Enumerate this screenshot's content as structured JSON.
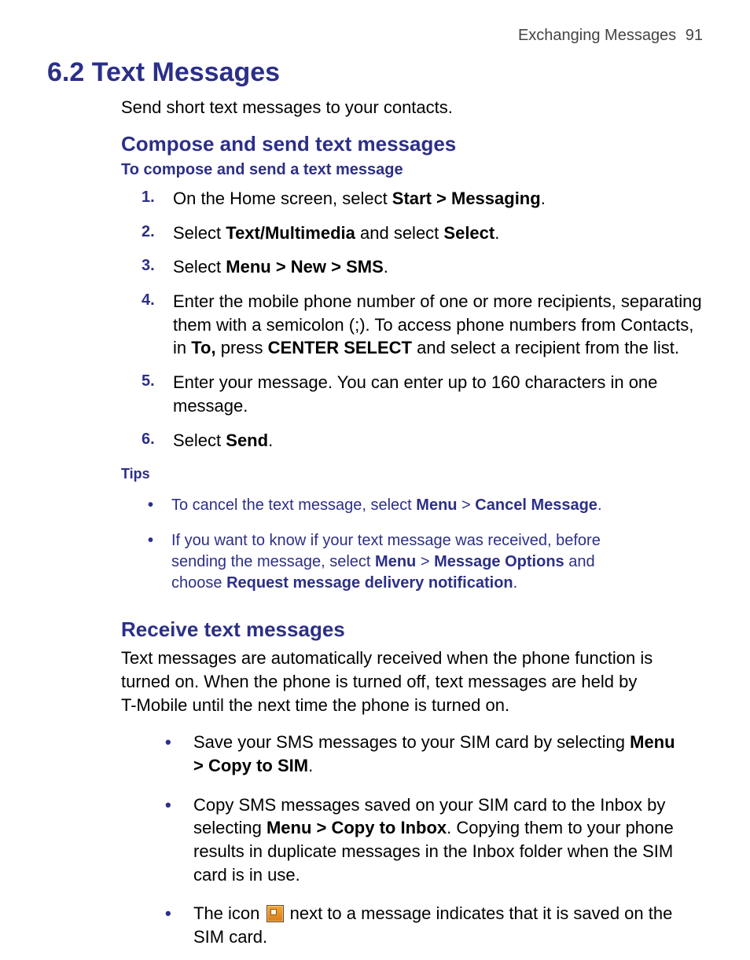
{
  "runningHead": {
    "title": "Exchanging Messages",
    "pageNumber": "91"
  },
  "sectionTitle": "6.2 Text Messages",
  "intro": "Send short text messages to your contacts.",
  "compose": {
    "heading": "Compose and send text messages",
    "task": "To compose and send a text message",
    "steps": {
      "s1_a": "On the Home screen, select ",
      "s1_b": "Start > Messaging",
      "s1_c": ".",
      "s2_a": "Select ",
      "s2_b": "Text/Multimedia",
      "s2_c": " and select ",
      "s2_d": "Select",
      "s2_e": ".",
      "s3_a": "Select ",
      "s3_b": "Menu > New > SMS",
      "s3_c": ".",
      "s4_a": "Enter the mobile phone number of one or more recipients, separating them with a semicolon (;). To access phone numbers from Contacts, in ",
      "s4_b": "To,",
      "s4_c": " press ",
      "s4_d": "CENTER SELECT",
      "s4_e": " and select a recipient from the list.",
      "s5": "Enter your message. You can enter up to 160 characters in one message.",
      "s6_a": "Select ",
      "s6_b": "Send",
      "s6_c": "."
    }
  },
  "tipsLabel": "Tips",
  "tips": {
    "t1_a": "To cancel the text message, select ",
    "t1_b": "Menu",
    "t1_c": " > ",
    "t1_d": "Cancel Message",
    "t1_e": ".",
    "t2_a": "If you want to know if your text message was received, before sending the message, select ",
    "t2_b": "Menu",
    "t2_c": " > ",
    "t2_d": "Message Options",
    "t2_e": " and choose ",
    "t2_f": "Request message delivery notification",
    "t2_g": "."
  },
  "receive": {
    "heading": "Receive text messages",
    "para": "Text messages are automatically received when the phone function is turned on. When the phone is turned off, text messages are held by T-Mobile until the next time the phone is turned on.",
    "b1_a": "Save your SMS messages to your SIM card by selecting ",
    "b1_b": "Menu > Copy to SIM",
    "b1_c": ".",
    "b2_a": "Copy SMS messages saved on your SIM card to the Inbox by selecting ",
    "b2_b": "Menu > Copy to Inbox",
    "b2_c": ". Copying them to your phone results in duplicate messages in the Inbox folder when the SIM card is in use.",
    "b3_a": "The icon ",
    "b3_b": " next to a message indicates that it is saved on the SIM card."
  }
}
